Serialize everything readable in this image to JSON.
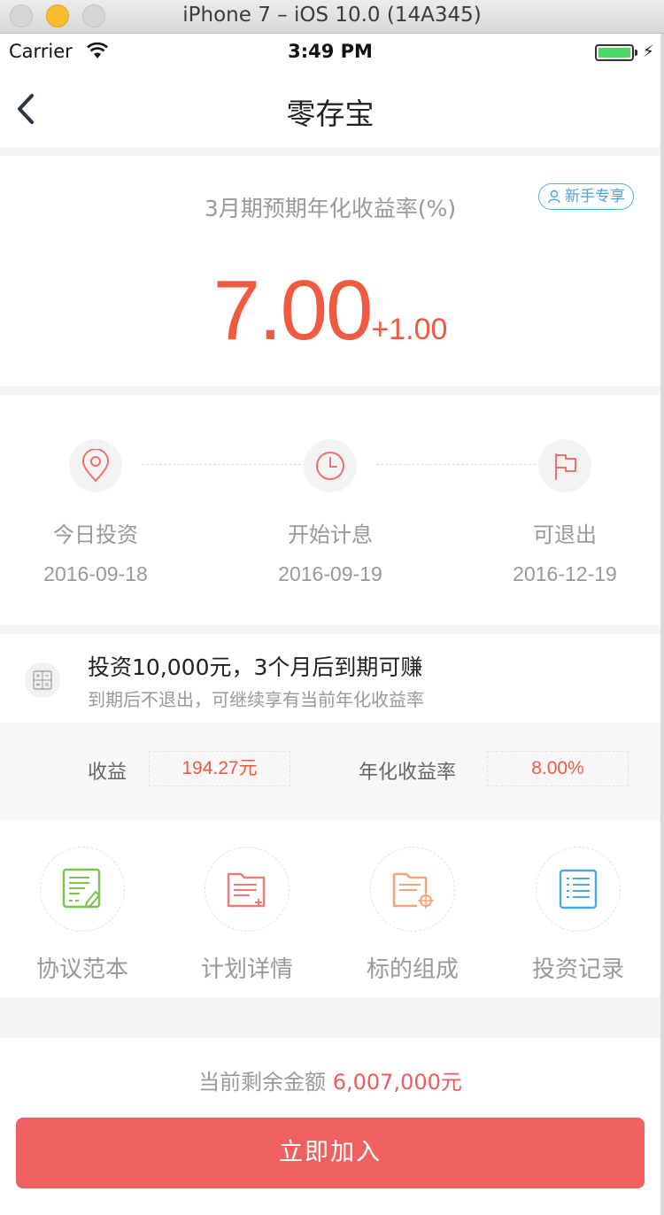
{
  "window": {
    "title": "iPhone 7 – iOS 10.0 (14A345)"
  },
  "status_bar": {
    "carrier": "Carrier",
    "time": "3:49 PM"
  },
  "nav": {
    "title": "零存宝"
  },
  "rate": {
    "label": "3月期预期年化收益率(%)",
    "badge": "新手专享",
    "value": "7.00",
    "bonus": "+1.00"
  },
  "timeline": [
    {
      "label": "今日投资",
      "date": "2016-09-18",
      "icon": "location-pin-icon"
    },
    {
      "label": "开始计息",
      "date": "2016-09-19",
      "icon": "clock-icon"
    },
    {
      "label": "可退出",
      "date": "2016-12-19",
      "icon": "flag-icon"
    }
  ],
  "calculator": {
    "title": "投资10,000元，3个月后到期可赚",
    "subtitle": "到期后不退出，可继续享有当前年化收益率",
    "profit_label": "收益",
    "profit_value": "194.27元",
    "rate_label": "年化收益率",
    "rate_value": "8.00%"
  },
  "menu": [
    {
      "label": "协议范本",
      "icon": "contract-icon",
      "color": "#7cc24e"
    },
    {
      "label": "计划详情",
      "icon": "plan-folder-icon",
      "color": "#f07a7a"
    },
    {
      "label": "标的组成",
      "icon": "target-folder-icon",
      "color": "#f5a27a"
    },
    {
      "label": "投资记录",
      "icon": "record-list-icon",
      "color": "#4aa8e8"
    }
  ],
  "footer": {
    "remain_label": "当前剩余金额",
    "remain_value": "6,007,000元",
    "join_button": "立即加入"
  },
  "colors": {
    "accent": "#ef5a40",
    "button": "#ef6060",
    "badge": "#4aa3e5"
  }
}
